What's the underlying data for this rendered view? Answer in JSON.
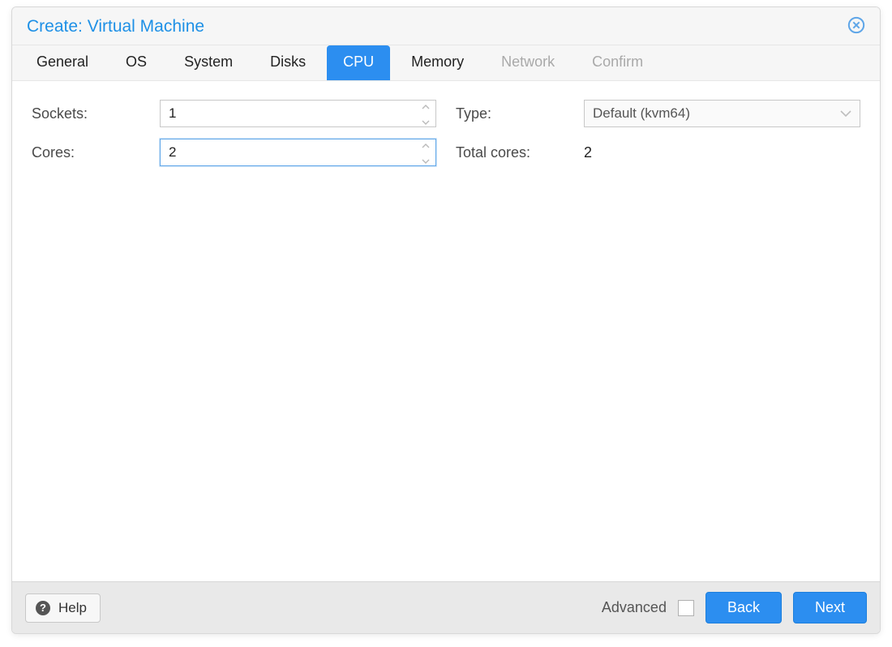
{
  "dialog": {
    "title": "Create: Virtual Machine"
  },
  "tabs": {
    "general": "General",
    "os": "OS",
    "system": "System",
    "disks": "Disks",
    "cpu": "CPU",
    "memory": "Memory",
    "network": "Network",
    "confirm": "Confirm"
  },
  "form": {
    "sockets_label": "Sockets:",
    "sockets_value": "1",
    "cores_label": "Cores:",
    "cores_value": "2",
    "type_label": "Type:",
    "type_value": "Default (kvm64)",
    "total_cores_label": "Total cores:",
    "total_cores_value": "2"
  },
  "footer": {
    "help_label": "Help",
    "advanced_label": "Advanced",
    "back_label": "Back",
    "next_label": "Next"
  }
}
